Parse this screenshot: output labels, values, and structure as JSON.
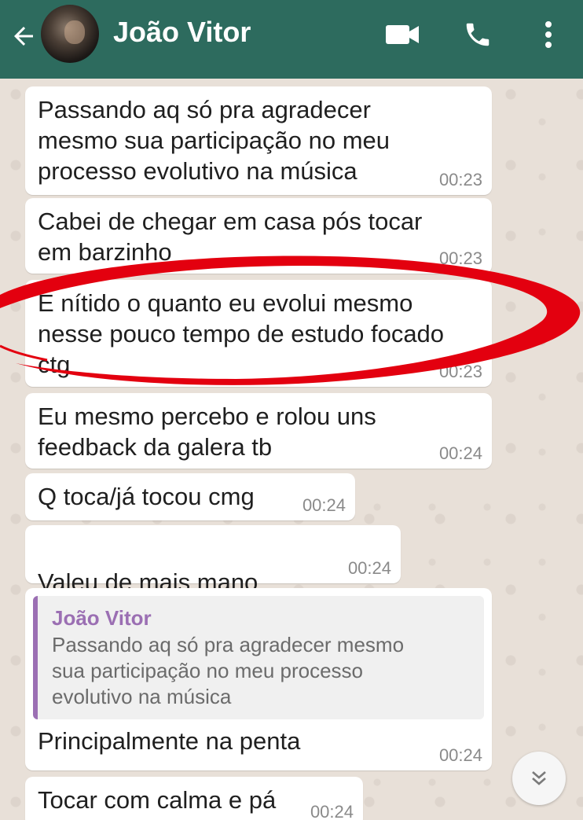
{
  "header": {
    "back_icon": "arrow-left-icon",
    "contact_name": "João Vitor",
    "video_icon": "video-camera-icon",
    "call_icon": "phone-icon",
    "menu_icon": "more-vert-icon"
  },
  "messages": [
    {
      "text": "Passando aq só pra agradecer\nmesmo sua participação no meu\nprocesso evolutivo na música",
      "time": "00:23"
    },
    {
      "text": "Cabei de chegar em casa pós tocar\nem barzinho",
      "time": "00:23"
    },
    {
      "text": "É nítido o quanto eu evolui mesmo\nnesse pouco tempo de estudo focado\nctg",
      "time": "00:23"
    },
    {
      "text": "Eu mesmo percebo e rolou uns\nfeedback da galera tb",
      "time": "00:24"
    },
    {
      "text": "Q toca/já tocou cmg",
      "time": "00:24"
    },
    {
      "text": "Valeu de mais mano",
      "emoji": "❤️",
      "time": "00:24"
    },
    {
      "quote": {
        "author": "João Vitor",
        "text": "Passando aq só pra agradecer mesmo\nsua participação no meu processo\nevolutivo na música"
      },
      "text": "Principalmente na penta",
      "time": "00:24"
    },
    {
      "text": "Tocar com calma e pá",
      "time": "00:24"
    }
  ],
  "scroll_icon": "chevron-double-down-icon",
  "colors": {
    "appbar": "#2d6b5e",
    "quote_accent": "#9b6fb3",
    "annotation_ring": "#e3000f"
  }
}
